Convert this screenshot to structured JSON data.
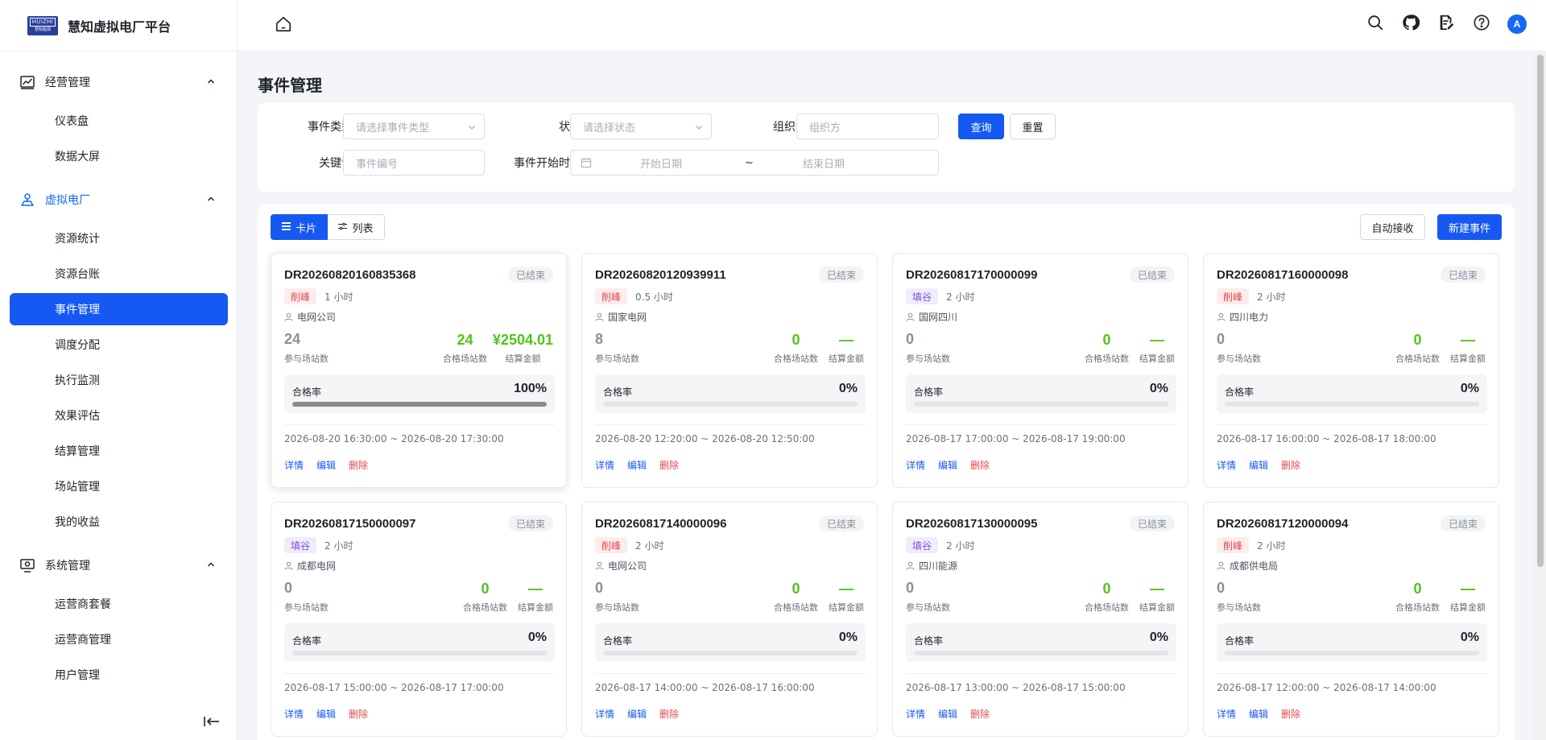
{
  "header": {
    "logo_text": "HUIZHI",
    "logo_subtext": "慧知能源",
    "app_title": "慧知虚拟电厂平台",
    "avatar_letter": "A",
    "icons": [
      "home-icon",
      "search-icon",
      "github-icon",
      "document-edit-icon",
      "help-icon"
    ]
  },
  "sidebar": {
    "groups": [
      {
        "label": "经营管理",
        "icon": "chart-icon",
        "expanded": true,
        "items": [
          "仪表盘",
          "数据大屏"
        ]
      },
      {
        "label": "虚拟电厂",
        "icon": "location-network-icon",
        "expanded": true,
        "active": true,
        "items": [
          "资源统计",
          "资源台账",
          "事件管理",
          "调度分配",
          "执行监测",
          "效果评估",
          "结算管理",
          "场站管理",
          "我的收益"
        ]
      },
      {
        "label": "系统管理",
        "icon": "monitor-icon",
        "expanded": true,
        "items": [
          "运营商套餐",
          "运营商管理",
          "用户管理"
        ]
      }
    ],
    "active_item": "事件管理"
  },
  "page": {
    "title": "事件管理"
  },
  "filters": {
    "event_type_label": "事件类型",
    "event_type_placeholder": "请选择事件类型",
    "status_label": "状态",
    "status_placeholder": "请选择状态",
    "org_label": "组织方",
    "org_placeholder": "组织方",
    "query_button": "查询",
    "reset_button": "重置",
    "keyword_label": "关键词",
    "keyword_placeholder": "事件编号",
    "time_label": "事件开始时间",
    "start_placeholder": "开始日期",
    "range_separator": "~",
    "end_placeholder": "结束日期"
  },
  "toolbar": {
    "card_view": "卡片",
    "list_view": "列表",
    "auto_accept": "自动接收",
    "new_event": "新建事件"
  },
  "labels": {
    "participants": "参与场站数",
    "qualified": "合格场站数",
    "amount": "结算金额",
    "rate": "合格率",
    "detail": "详情",
    "edit": "编辑",
    "delete": "删除"
  },
  "events": [
    {
      "id": "DR20260820160835368",
      "status": "已结束",
      "type": "削峰",
      "type_kind": "peak",
      "duration": "1 小时",
      "org": "电网公司",
      "participants": "24",
      "qualified": "24",
      "amount": "¥2504.01",
      "rate": "100%",
      "rate_value": 1.0,
      "time": "2026-08-20 16:30:00 ~ 2026-08-20 17:30:00"
    },
    {
      "id": "DR20260820120939911",
      "status": "已结束",
      "type": "削峰",
      "type_kind": "peak",
      "duration": "0.5 小时",
      "org": "国家电网",
      "participants": "8",
      "qualified": "0",
      "amount": "—",
      "rate": "0%",
      "rate_value": 0,
      "time": "2026-08-20 12:20:00 ~ 2026-08-20 12:50:00"
    },
    {
      "id": "DR20260817170000099",
      "status": "已结束",
      "type": "填谷",
      "type_kind": "valley",
      "duration": "2 小时",
      "org": "国网四川",
      "participants": "0",
      "qualified": "0",
      "amount": "—",
      "rate": "0%",
      "rate_value": 0,
      "time": "2026-08-17 17:00:00 ~ 2026-08-17 19:00:00"
    },
    {
      "id": "DR20260817160000098",
      "status": "已结束",
      "type": "削峰",
      "type_kind": "peak",
      "duration": "2 小时",
      "org": "四川电力",
      "participants": "0",
      "qualified": "0",
      "amount": "—",
      "rate": "0%",
      "rate_value": 0,
      "time": "2026-08-17 16:00:00 ~ 2026-08-17 18:00:00"
    },
    {
      "id": "DR20260817150000097",
      "status": "已结束",
      "type": "填谷",
      "type_kind": "valley",
      "duration": "2 小时",
      "org": "成都电网",
      "participants": "0",
      "qualified": "0",
      "amount": "—",
      "rate": "0%",
      "rate_value": 0,
      "time": "2026-08-17 15:00:00 ~ 2026-08-17 17:00:00"
    },
    {
      "id": "DR20260817140000096",
      "status": "已结束",
      "type": "削峰",
      "type_kind": "peak",
      "duration": "2 小时",
      "org": "电网公司",
      "participants": "0",
      "qualified": "0",
      "amount": "—",
      "rate": "0%",
      "rate_value": 0,
      "time": "2026-08-17 14:00:00 ~ 2026-08-17 16:00:00"
    },
    {
      "id": "DR20260817130000095",
      "status": "已结束",
      "type": "填谷",
      "type_kind": "valley",
      "duration": "2 小时",
      "org": "四川能源",
      "participants": "0",
      "qualified": "0",
      "amount": "—",
      "rate": "0%",
      "rate_value": 0,
      "time": "2026-08-17 13:00:00 ~ 2026-08-17 15:00:00"
    },
    {
      "id": "DR20260817120000094",
      "status": "已结束",
      "type": "削峰",
      "type_kind": "peak",
      "duration": "2 小时",
      "org": "成都供电局",
      "participants": "0",
      "qualified": "0",
      "amount": "—",
      "rate": "0%",
      "rate_value": 0,
      "time": "2026-08-17 12:00:00 ~ 2026-08-17 14:00:00"
    }
  ],
  "colors": {
    "primary": "#1659f2",
    "peak": "#e5484d",
    "valley": "#7c4ee0",
    "success": "#52c41a"
  }
}
